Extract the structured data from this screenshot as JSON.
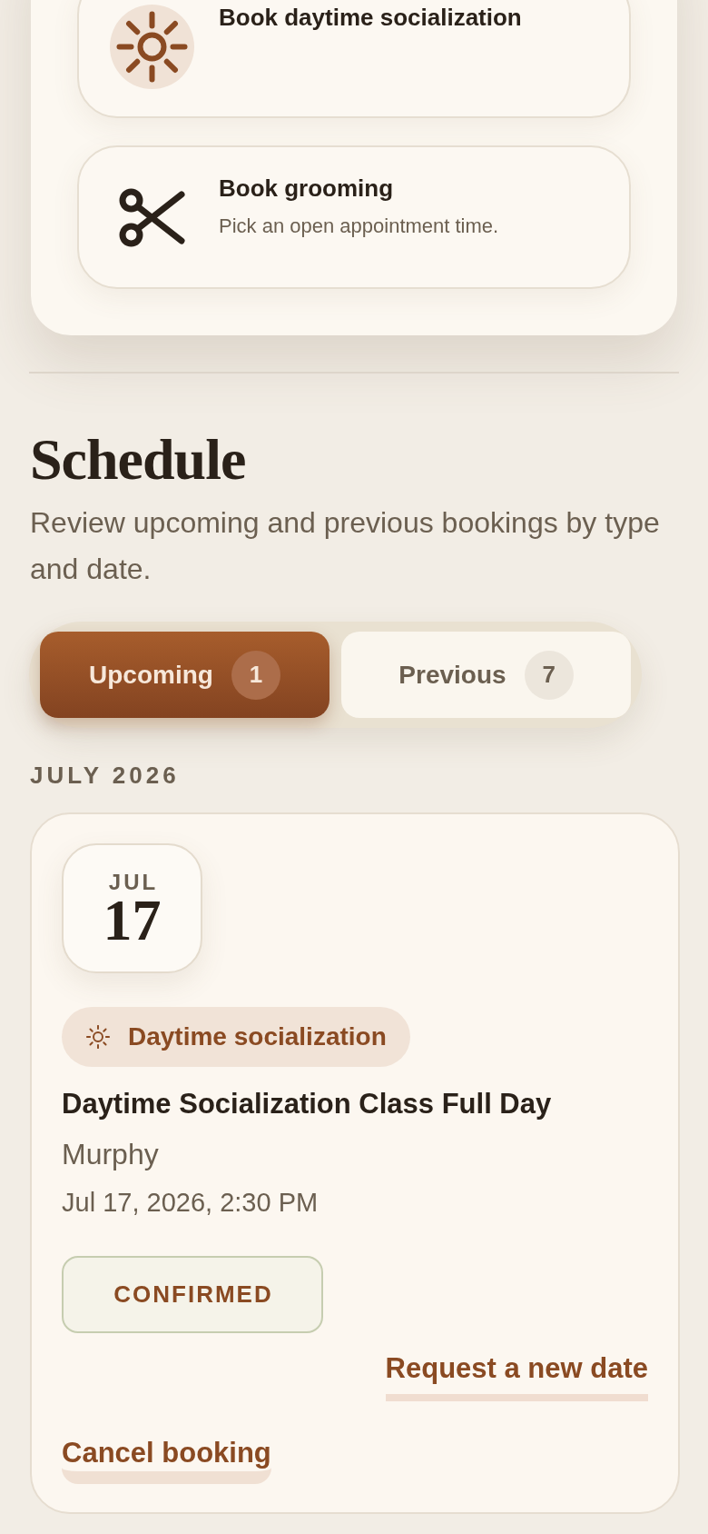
{
  "booking_options": [
    {
      "kind": "sun",
      "title": "Book daytime socialization"
    },
    {
      "kind": "scissors",
      "title": "Book grooming",
      "description": "Pick an open appointment time."
    }
  ],
  "schedule": {
    "title": "Schedule",
    "subtitle": "Review upcoming and previous bookings by type and date."
  },
  "tabs": [
    {
      "label": "Upcoming",
      "count": "1",
      "selected": true
    },
    {
      "label": "Previous",
      "count": "7",
      "selected": false
    }
  ],
  "month_heading": "JULY 2026",
  "bookings": [
    {
      "month": "JUL",
      "day": "17",
      "type": {
        "kind": "sun",
        "label": "Daytime socialization"
      },
      "title": "Daytime Socialization Class Full Day",
      "pet": "Murphy",
      "datetime": "Jul 17, 2026, 2:30 PM",
      "status": "CONFIRMED",
      "actions": [
        {
          "kind": "reschedule",
          "label": "Request a new date"
        },
        {
          "kind": "cancel",
          "label": "Cancel booking"
        }
      ]
    }
  ]
}
